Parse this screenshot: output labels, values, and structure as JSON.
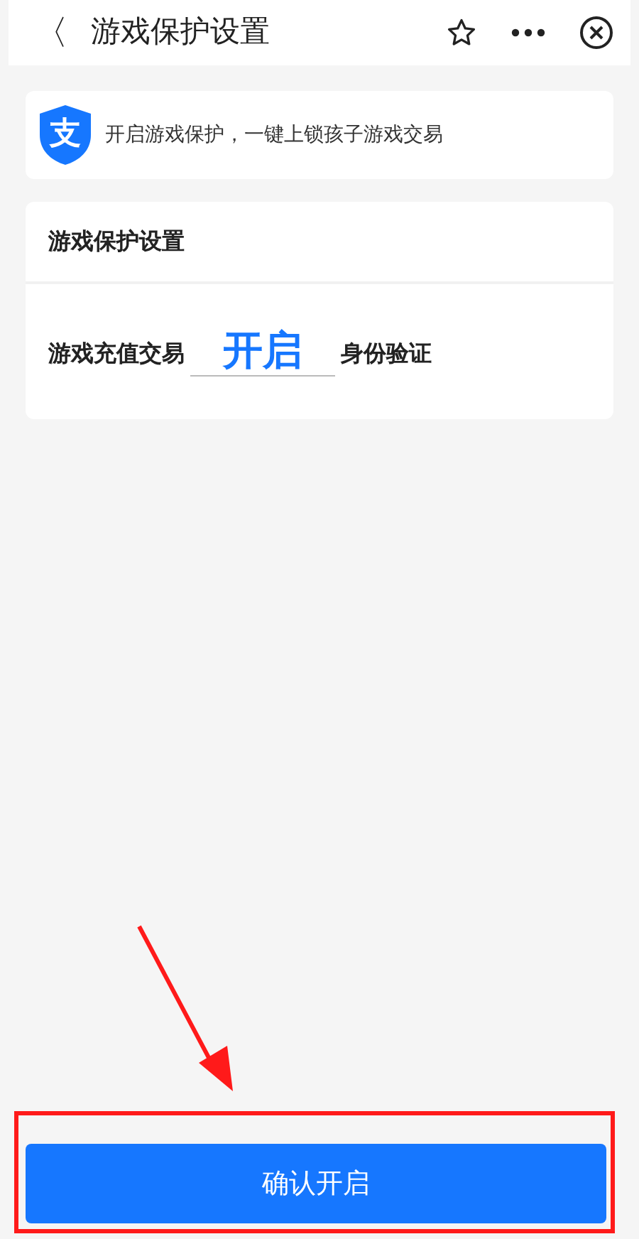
{
  "header": {
    "back": "〈",
    "title": "游戏保护设置"
  },
  "notice": {
    "logo_glyph": "支",
    "text": "开启游戏保护，一键上锁孩子游戏交易"
  },
  "settings": {
    "title": "游戏保护设置",
    "label_before": "游戏充值交易",
    "field_value": "开启",
    "label_after": "身份验证"
  },
  "confirm_button": {
    "label": "确认开启",
    "highlighted": true
  }
}
